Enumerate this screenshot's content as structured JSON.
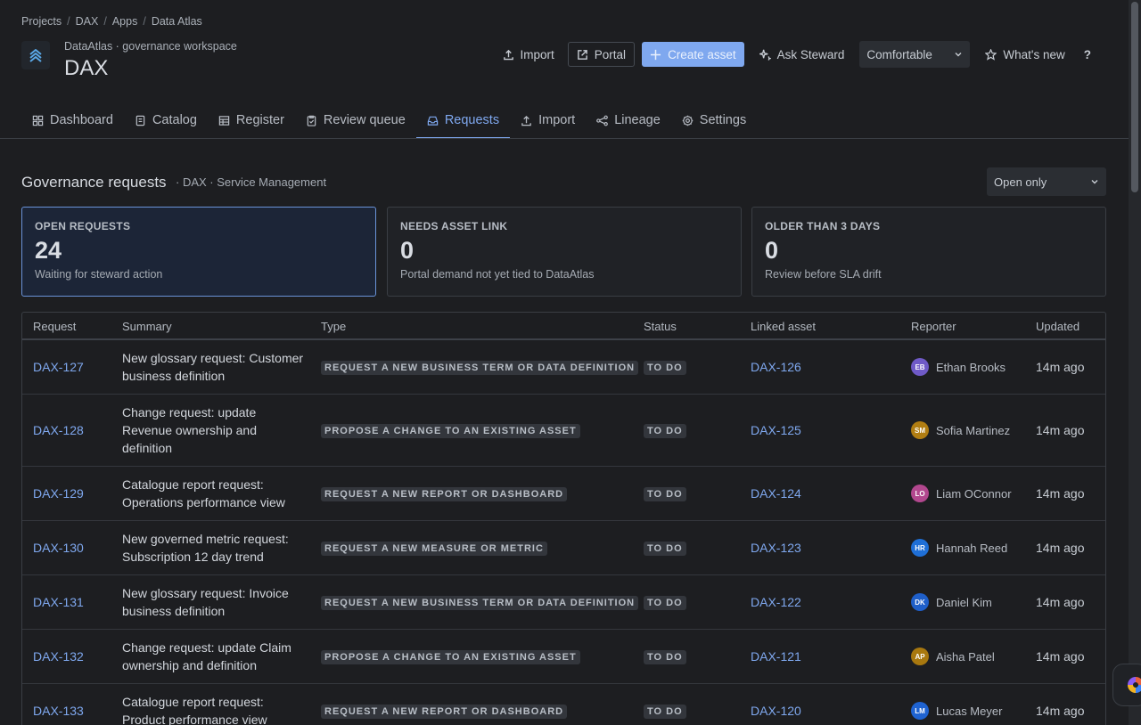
{
  "breadcrumb": {
    "items": [
      "Projects",
      "DAX",
      "Apps",
      "Data Atlas"
    ],
    "separator": "/"
  },
  "header": {
    "workspace": "DataAtlas · governance workspace",
    "title": "DAX"
  },
  "actions": {
    "import_label": "Import",
    "portal_label": "Portal",
    "create_label": "Create asset",
    "steward_label": "Ask Steward",
    "density_value": "Comfortable",
    "whats_new_label": "What's new",
    "help_label": "?"
  },
  "tabs": [
    {
      "label": "Dashboard",
      "icon": "dashboard-icon"
    },
    {
      "label": "Catalog",
      "icon": "book-icon"
    },
    {
      "label": "Register",
      "icon": "table-icon"
    },
    {
      "label": "Review queue",
      "icon": "clipboard-check-icon"
    },
    {
      "label": "Requests",
      "icon": "inbox-icon",
      "active": true
    },
    {
      "label": "Import",
      "icon": "upload-icon"
    },
    {
      "label": "Lineage",
      "icon": "lineage-icon"
    },
    {
      "label": "Settings",
      "icon": "gear-icon"
    }
  ],
  "section": {
    "title": "Governance requests",
    "subtitle": "· DAX · Service Management",
    "filter_value": "Open only"
  },
  "cards": [
    {
      "label": "OPEN REQUESTS",
      "value": "24",
      "desc": "Waiting for steward action",
      "active": true
    },
    {
      "label": "NEEDS ASSET LINK",
      "value": "0",
      "desc": "Portal demand not yet tied to DataAtlas",
      "active": false
    },
    {
      "label": "OLDER THAN 3 DAYS",
      "value": "0",
      "desc": "Review before SLA drift",
      "active": false
    }
  ],
  "table": {
    "columns": [
      "Request",
      "Summary",
      "Type",
      "Status",
      "Linked asset",
      "Reporter",
      "Updated"
    ],
    "rows": [
      {
        "id": "DAX-127",
        "summary": "New glossary request: Customer business definition",
        "type": "REQUEST A NEW BUSINESS TERM OR DATA DEFINITION",
        "status": "TO DO",
        "linked": "DAX-126",
        "initials": "EB",
        "reporter": "Ethan Brooks",
        "avatar_color": "#6f5ac7",
        "updated": "14m ago"
      },
      {
        "id": "DAX-128",
        "summary": "Change request: update Revenue ownership and definition",
        "type": "PROPOSE A CHANGE TO AN EXISTING ASSET",
        "status": "TO DO",
        "linked": "DAX-125",
        "initials": "SM",
        "reporter": "Sofia Martinez",
        "avatar_color": "#b07d12",
        "updated": "14m ago"
      },
      {
        "id": "DAX-129",
        "summary": "Catalogue report request: Operations performance view",
        "type": "REQUEST A NEW REPORT OR DASHBOARD",
        "status": "TO DO",
        "linked": "DAX-124",
        "initials": "LO",
        "reporter": "Liam OConnor",
        "avatar_color": "#b2478e",
        "updated": "14m ago"
      },
      {
        "id": "DAX-130",
        "summary": "New governed metric request: Subscription 12 day trend",
        "type": "REQUEST A NEW MEASURE OR METRIC",
        "status": "TO DO",
        "linked": "DAX-123",
        "initials": "HR",
        "reporter": "Hannah Reed",
        "avatar_color": "#1f6fd6",
        "updated": "14m ago"
      },
      {
        "id": "DAX-131",
        "summary": "New glossary request: Invoice business definition",
        "type": "REQUEST A NEW BUSINESS TERM OR DATA DEFINITION",
        "status": "TO DO",
        "linked": "DAX-122",
        "initials": "DK",
        "reporter": "Daniel Kim",
        "avatar_color": "#1f5fc9",
        "updated": "14m ago"
      },
      {
        "id": "DAX-132",
        "summary": "Change request: update Claim ownership and definition",
        "type": "PROPOSE A CHANGE TO AN EXISTING ASSET",
        "status": "TO DO",
        "linked": "DAX-121",
        "initials": "AP",
        "reporter": "Aisha Patel",
        "avatar_color": "#a8780f",
        "updated": "14m ago"
      },
      {
        "id": "DAX-133",
        "summary": "Catalogue report request: Product performance view",
        "type": "REQUEST A NEW REPORT OR DASHBOARD",
        "status": "TO DO",
        "linked": "DAX-120",
        "initials": "LM",
        "reporter": "Lucas Meyer",
        "avatar_color": "#1f63d1",
        "updated": "14m ago"
      }
    ]
  },
  "colors": {
    "accent": "#7fa8ef",
    "background": "#1d1e21"
  }
}
